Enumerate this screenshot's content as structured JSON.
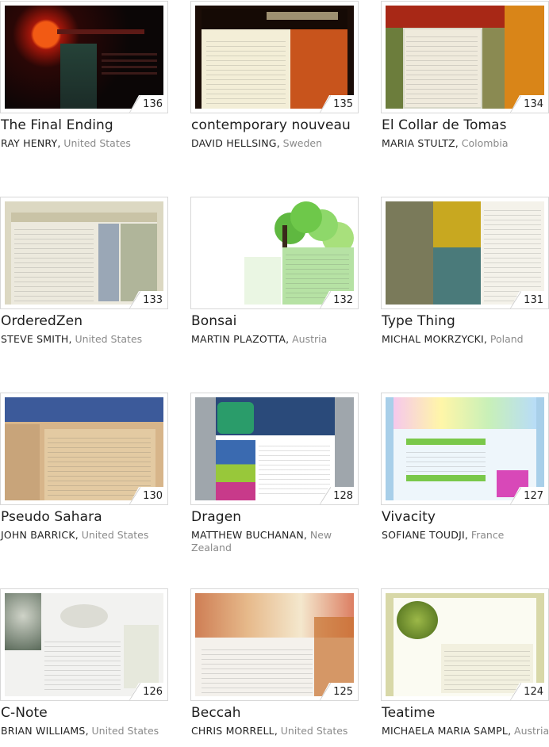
{
  "designs": [
    {
      "number": "136",
      "title": "The Final Ending",
      "author": "RAY HENRY",
      "country": "United States"
    },
    {
      "number": "135",
      "title": "contemporary nouveau",
      "author": "DAVID HELLSING",
      "country": "Sweden"
    },
    {
      "number": "134",
      "title": "El Collar de Tomas",
      "author": "MARIA STULTZ",
      "country": "Colombia"
    },
    {
      "number": "133",
      "title": "OrderedZen",
      "author": "STEVE SMITH",
      "country": "United States"
    },
    {
      "number": "132",
      "title": "Bonsai",
      "author": "MARTIN PLAZOTTA",
      "country": "Austria"
    },
    {
      "number": "131",
      "title": "Type Thing",
      "author": "MICHAL MOKRZYCKI",
      "country": "Poland"
    },
    {
      "number": "130",
      "title": "Pseudo Sahara",
      "author": "JOHN BARRICK",
      "country": "United States"
    },
    {
      "number": "128",
      "title": "Dragen",
      "author": "MATTHEW BUCHANAN",
      "country": "New Zealand"
    },
    {
      "number": "127",
      "title": "Vivacity",
      "author": "SOFIANE TOUDJI",
      "country": "France"
    },
    {
      "number": "126",
      "title": "C-Note",
      "author": "BRIAN WILLIAMS",
      "country": "United States"
    },
    {
      "number": "125",
      "title": "Beccah",
      "author": "CHRIS MORRELL",
      "country": "United States"
    },
    {
      "number": "124",
      "title": "Teatime",
      "author": "MICHAELA MARIA SAMPL",
      "country": "Austria"
    }
  ]
}
